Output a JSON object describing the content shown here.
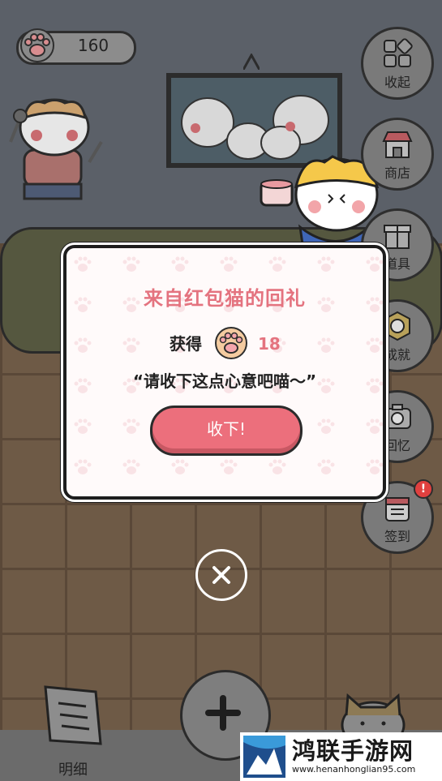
{
  "hud": {
    "paw_count": "160"
  },
  "side_menu": [
    {
      "label": "收起",
      "icon": "collapse-grid-icon"
    },
    {
      "label": "商店",
      "icon": "shop-icon"
    },
    {
      "label": "道具",
      "icon": "gift-box-icon"
    },
    {
      "label": "成就",
      "icon": "achievement-badge-icon"
    },
    {
      "label": "回忆",
      "icon": "camera-icon"
    },
    {
      "label": "签到",
      "icon": "calendar-icon",
      "badge": "!"
    }
  ],
  "dialog": {
    "title": "来自红包猫的回礼",
    "reward_label": "获得",
    "reward_icon": "paw-coin-icon",
    "reward_value": "18",
    "message": "“请收下这点心意吧喵～”",
    "accept_label": "收下!"
  },
  "bottom": {
    "detail_label": "明细"
  },
  "watermark": {
    "title": "鸿联手游网",
    "url": "www.henanhonglian95.com"
  },
  "colors": {
    "accent": "#ec6f7c",
    "title": "#e4737f"
  }
}
